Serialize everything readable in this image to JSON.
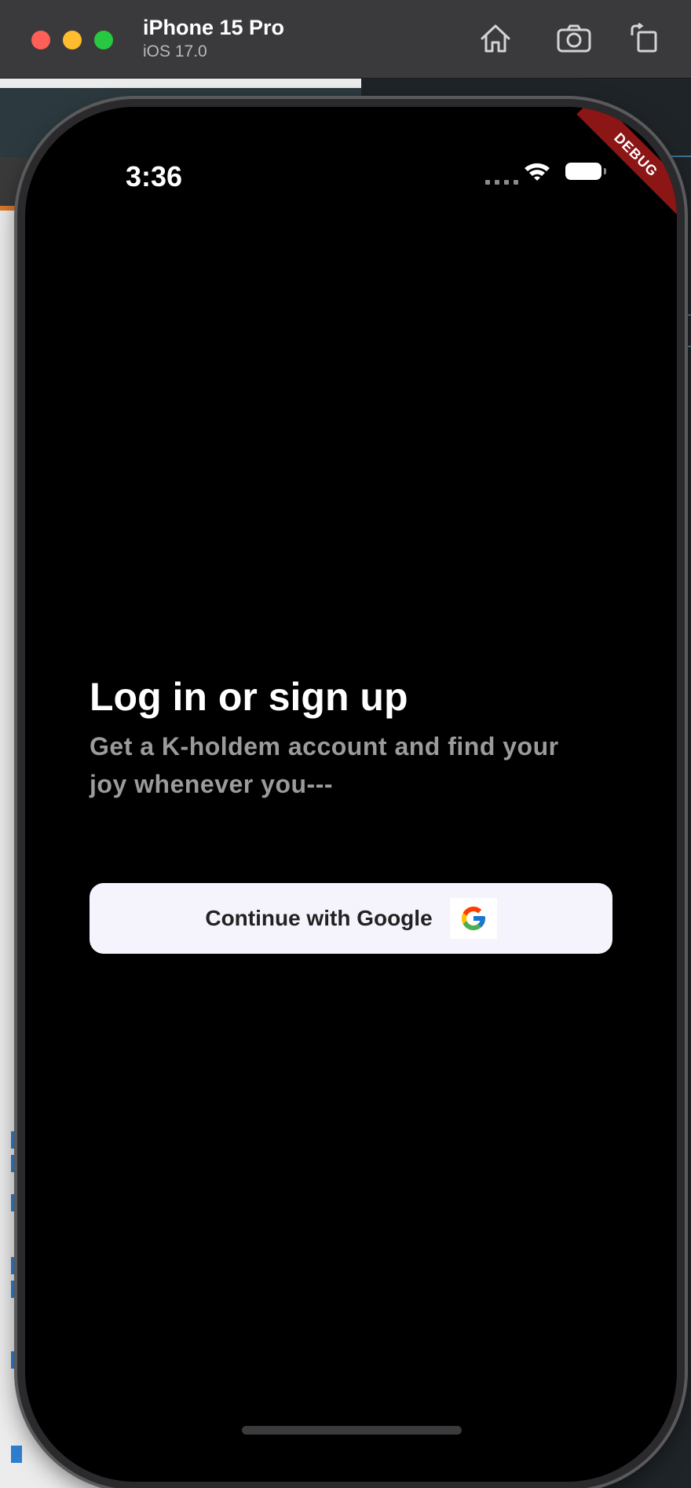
{
  "titlebar": {
    "device_name": "iPhone 15 Pro",
    "os_version": "iOS 17.0",
    "icons": [
      "home-icon",
      "screenshot-icon",
      "rotate-icon"
    ]
  },
  "status_bar": {
    "time": "3:36",
    "icons": [
      "cellular-icon",
      "wifi-icon",
      "battery-icon"
    ]
  },
  "debug_banner": "DEBUG",
  "login": {
    "title": "Log in or sign up",
    "subtitle": "Get a K-holdem account and find your joy whenever you---",
    "google_button_label": "Continue with Google",
    "google_icon": "google-logo-icon"
  },
  "colors": {
    "screen_bg": "#000000",
    "title": "#ffffff",
    "subtitle": "#9b9b9e",
    "button_bg": "#f5f3fc",
    "debug_ribbon": "#8c1515"
  }
}
